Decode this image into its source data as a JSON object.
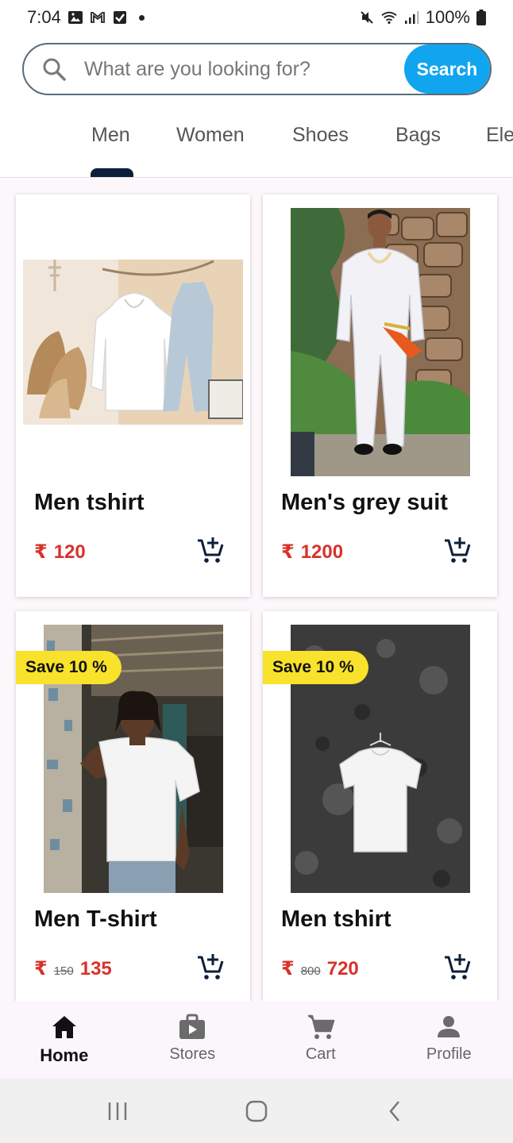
{
  "status_bar": {
    "time": "7:04",
    "battery": "100%"
  },
  "search": {
    "placeholder": "What are you looking for?",
    "button_label": "Search"
  },
  "tabs": [
    {
      "label": "Men"
    },
    {
      "label": "Women"
    },
    {
      "label": "Shoes"
    },
    {
      "label": "Bags"
    },
    {
      "label": "Ele"
    }
  ],
  "products": [
    {
      "title": "Men tshirt",
      "currency": "₹",
      "price": "120"
    },
    {
      "title": "Men's grey suit",
      "currency": "₹",
      "price": "1200"
    },
    {
      "title": "Men T-shirt",
      "currency": "₹",
      "old_price": "150",
      "price": "135",
      "badge": "Save 10 %"
    },
    {
      "title": "Men tshirt",
      "currency": "₹",
      "old_price": "800",
      "price": "720",
      "badge": "Save 10 %"
    }
  ],
  "bottom_nav": [
    {
      "label": "Home"
    },
    {
      "label": "Stores"
    },
    {
      "label": "Cart"
    },
    {
      "label": "Profile"
    }
  ],
  "colors": {
    "accent": "#12a5ef",
    "price": "#d7322b",
    "badge": "#f8e22b",
    "tab_indicator": "#0b1f3a"
  }
}
